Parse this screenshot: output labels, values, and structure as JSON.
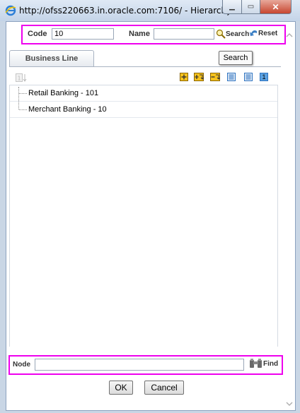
{
  "window": {
    "title": "http://ofss220663.in.oracle.com:7106/ - Hierarchy B...",
    "minimize_glyph": "▁",
    "maximize_glyph": "▭",
    "close_glyph": "✕"
  },
  "search": {
    "code_label": "Code",
    "code_value": "10",
    "name_label": "Name",
    "name_value": "",
    "search_label": "Search",
    "reset_label": "Reset"
  },
  "tabs": [
    {
      "label": "Business Line",
      "active": true
    }
  ],
  "tooltip": {
    "text": "Search"
  },
  "toolbar": {
    "icons": [
      "sort-icon",
      "expand-all-icon",
      "expand-branch-icon",
      "collapse-branch-icon",
      "show-code-icon",
      "show-name-icon",
      "level-one-icon"
    ],
    "level_label": "1"
  },
  "tree": {
    "items": [
      {
        "label": "Retail Banking - 101"
      },
      {
        "label": "Merchant Banking - 10"
      }
    ]
  },
  "node": {
    "label": "Node",
    "value": "",
    "find_label": "Find"
  },
  "buttons": {
    "ok_label": "OK",
    "cancel_label": "Cancel"
  },
  "colors": {
    "highlight": "#ee00ee",
    "toolbar_icon": "#f0b400",
    "toolbar_icon_blue": "#2f74c0"
  }
}
